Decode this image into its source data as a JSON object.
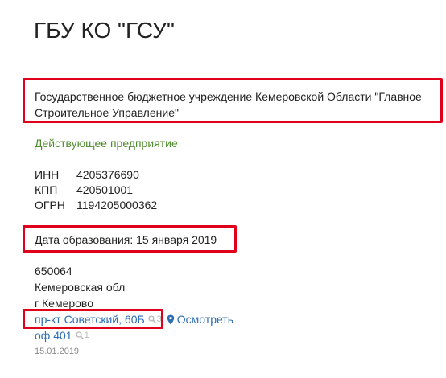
{
  "header": {
    "title": "ГБУ КО \"ГСУ\""
  },
  "company": {
    "full_name": "Государственное бюджетное учреждение Кемеровской Области \"Главное Строительное Управление\"",
    "status": "Действующее предприятие",
    "codes": [
      {
        "key": "ИНН",
        "value": "4205376690"
      },
      {
        "key": "КПП",
        "value": "420501001"
      },
      {
        "key": "ОГРН",
        "value": "1194205000362"
      }
    ],
    "founded": "Дата образования: 15 января 2019"
  },
  "address": {
    "postcode": "650064",
    "region": "Кемеровская обл",
    "city": "г Кемерово",
    "street_link": "пр-кт Советский, 60Б",
    "street_search_count": "3",
    "view_link": "Осмотреть",
    "office_link": "оф 401",
    "office_search_count": "1",
    "date": "15.01.2019"
  },
  "colors": {
    "status_green": "#4e8c2e",
    "link_blue": "#2d6db5",
    "highlight_red": "#e0001b"
  }
}
